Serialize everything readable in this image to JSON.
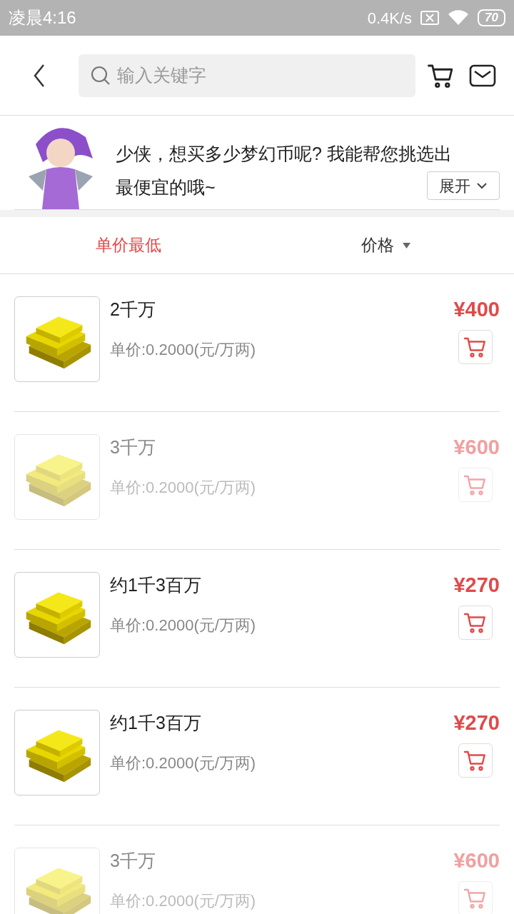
{
  "status_bar": {
    "time": "凌晨4:16",
    "net_speed": "0.4K/s",
    "battery": "70"
  },
  "search": {
    "placeholder": "输入关键字"
  },
  "banner": {
    "message_lines": [
      "少侠，想买多少梦幻币呢? 我能帮您挑选出",
      "最便宜的哦~"
    ],
    "expand_button": "展开"
  },
  "sort_tabs": [
    {
      "label": "单价最低",
      "selected": true,
      "has_caret": false
    },
    {
      "label": "价格",
      "selected": false,
      "has_caret": true
    }
  ],
  "items": [
    {
      "title": "2千万",
      "unit_price": "单价:0.2000(元/万两)",
      "price": "¥400",
      "disabled": false
    },
    {
      "title": "3千万",
      "unit_price": "单价:0.2000(元/万两)",
      "price": "¥600",
      "disabled": true
    },
    {
      "title": "约1千3百万",
      "unit_price": "单价:0.2000(元/万两)",
      "price": "¥270",
      "disabled": false
    },
    {
      "title": "约1千3百万",
      "unit_price": "单价:0.2000(元/万两)",
      "price": "¥270",
      "disabled": false
    },
    {
      "title": "3千万",
      "unit_price": "单价:0.2000(元/万两)",
      "price": "¥600",
      "disabled": true
    }
  ]
}
